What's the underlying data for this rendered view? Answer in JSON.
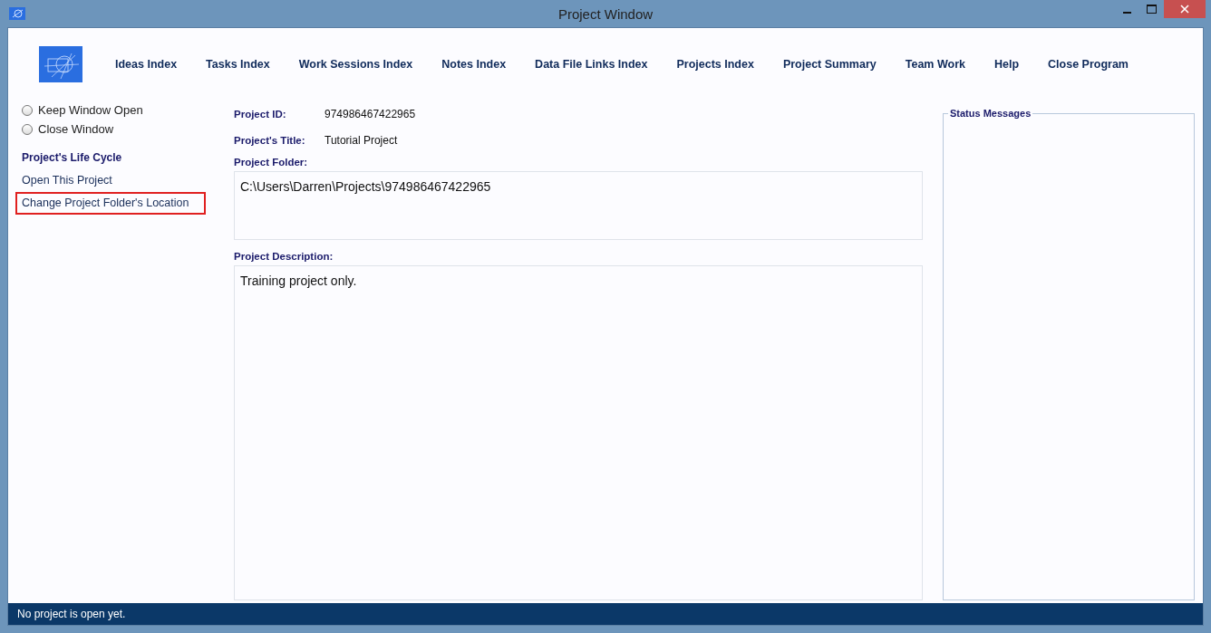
{
  "window": {
    "title": "Project Window"
  },
  "menu": [
    {
      "label": "Ideas Index"
    },
    {
      "label": "Tasks Index"
    },
    {
      "label": "Work Sessions Index"
    },
    {
      "label": "Notes Index"
    },
    {
      "label": "Data File Links Index"
    },
    {
      "label": "Projects Index"
    },
    {
      "label": "Project Summary"
    },
    {
      "label": "Team Work"
    },
    {
      "label": "Help"
    },
    {
      "label": "Close Program"
    }
  ],
  "window_options": [
    {
      "label": "Keep Window Open",
      "selected": false
    },
    {
      "label": "Close Window",
      "selected": false
    }
  ],
  "life_cycle": {
    "heading": "Project's Life Cycle",
    "items": [
      {
        "label": "Open This Project",
        "highlighted": false
      },
      {
        "label": "Change Project Folder's Location",
        "highlighted": true
      }
    ]
  },
  "fields": {
    "id_label": "Project ID:",
    "id_value": "974986467422965",
    "title_label": "Project's Title:",
    "title_value": "Tutorial Project",
    "folder_label": "Project Folder:",
    "folder_value": "C:\\Users\\Darren\\Projects\\974986467422965",
    "description_label": "Project Description:",
    "description_value": "Training project only."
  },
  "status_messages": {
    "title": "Status Messages"
  },
  "status_bar": "No project is open yet."
}
